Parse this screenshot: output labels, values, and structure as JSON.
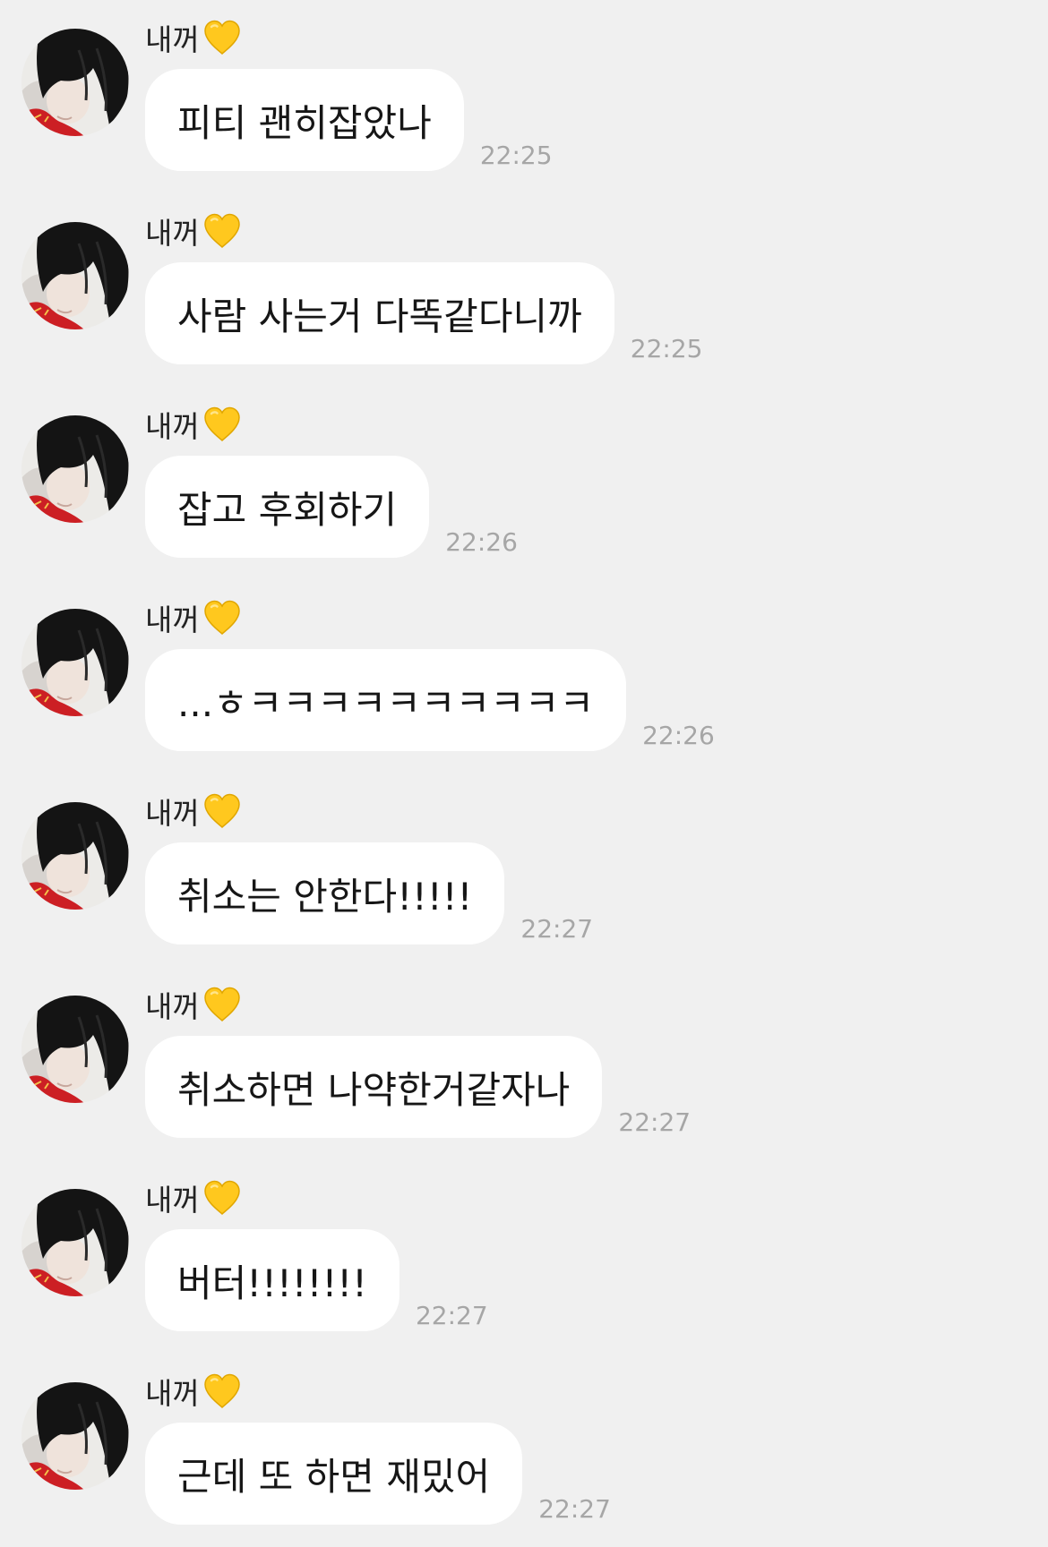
{
  "sender": {
    "name": "내꺼",
    "badge_icon": "yellow-heart-icon"
  },
  "colors": {
    "background": "#f0f0f0",
    "bubble": "#ffffff",
    "time": "#a6a6a6",
    "heart": "#ffc81e"
  },
  "messages": [
    {
      "text": "피티 괜히잡았나",
      "time": "22:25"
    },
    {
      "text": "사람 사는거 다똑같다니까",
      "time": "22:25"
    },
    {
      "text": "잡고 후회하기",
      "time": "22:26"
    },
    {
      "text": "...ㅎㅋㅋㅋㅋㅋㅋㅋㅋㅋㅋ",
      "time": "22:26"
    },
    {
      "text": "취소는 안한다!!!!!",
      "time": "22:27"
    },
    {
      "text": "취소하면 나약한거같자나",
      "time": "22:27"
    },
    {
      "text": "버터!!!!!!!!",
      "time": "22:27"
    },
    {
      "text": "근데 또 하면 재밌어",
      "time": "22:27"
    }
  ]
}
